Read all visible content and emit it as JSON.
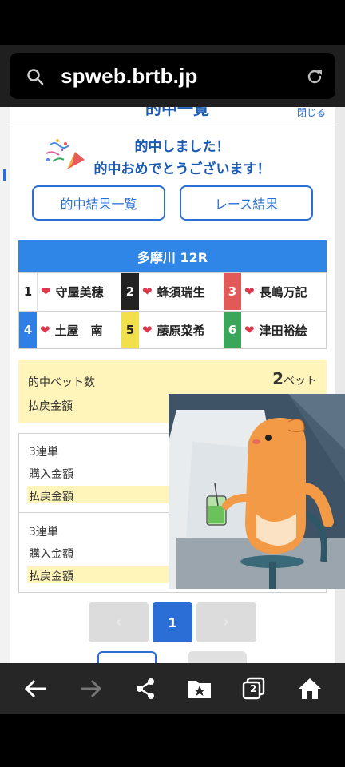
{
  "browser": {
    "url": "spweb.brtb.jp",
    "search_icon": "search-icon",
    "reload_icon": "reload-icon"
  },
  "modal": {
    "title": "的中一覧",
    "close_label": "閉じる",
    "message_line1": "的中しました！",
    "message_line2": "的中おめでとうございます！",
    "buttons": {
      "hit_list": "的中結果一覧",
      "race_result": "レース結果"
    },
    "race": {
      "header": "多摩川 12R",
      "racers": [
        {
          "num": "1",
          "name": "守屋美穂",
          "color": "#ffffff",
          "text_color": "#222222"
        },
        {
          "num": "2",
          "name": "蜂須瑞生",
          "color": "#222222",
          "text_color": "#ffffff"
        },
        {
          "num": "3",
          "name": "長嶋万記",
          "color": "#e05a5a",
          "text_color": "#ffffff"
        },
        {
          "num": "4",
          "name": "土屋　南",
          "color": "#2f7fe6",
          "text_color": "#ffffff"
        },
        {
          "num": "5",
          "name": "藤原菜希",
          "color": "#f2e04a",
          "text_color": "#222222"
        },
        {
          "num": "6",
          "name": "津田裕絵",
          "color": "#3aa65a",
          "text_color": "#ffffff"
        }
      ]
    },
    "summary": {
      "bet_count_label": "的中ベット数",
      "bet_count_value": "2",
      "bet_count_unit": "ベット",
      "payout_label": "払戻金額"
    },
    "details": [
      {
        "type": "3連単",
        "purchase_label": "購入金額",
        "payout_label": "払戻金額"
      },
      {
        "type": "3連単",
        "purchase_label": "購入金額",
        "payout_label": "払戻金額"
      }
    ],
    "pagination": {
      "prev": "‹",
      "current": "1",
      "next": "›"
    }
  },
  "nav": {
    "back": "back-icon",
    "forward": "forward-icon",
    "share": "share-icon",
    "bookmarks": "bookmark-star-icon",
    "tabs_count": "2",
    "home": "home-icon"
  },
  "colors": {
    "accent_blue": "#2a6ed6",
    "header_blue": "#2f86e6",
    "highlight_yellow": "#fff4ba",
    "heart_red": "#e0384b"
  }
}
